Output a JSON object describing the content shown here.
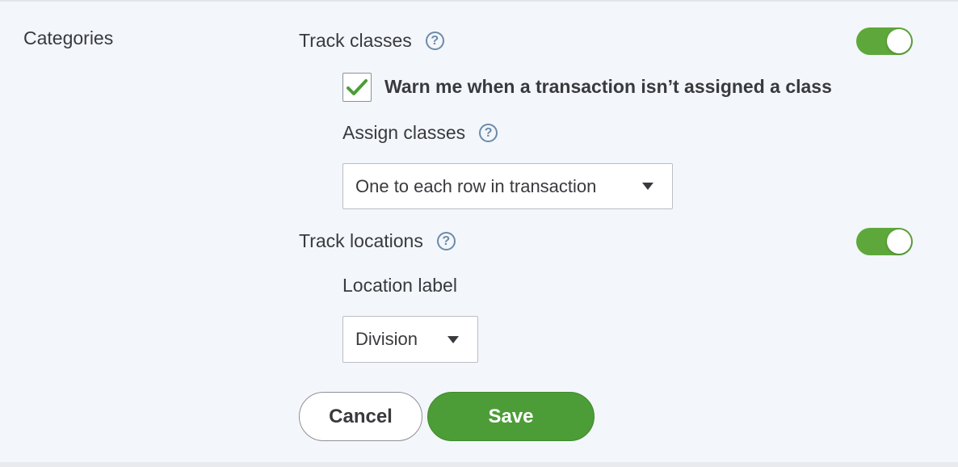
{
  "section": {
    "title": "Categories"
  },
  "track_classes": {
    "label": "Track classes",
    "help": "?",
    "enabled": true,
    "warn": {
      "checked": true,
      "label": "Warn me when a transaction isn’t assigned a class"
    },
    "assign": {
      "label": "Assign classes",
      "help": "?",
      "selected": "One to each row in transaction"
    }
  },
  "track_locations": {
    "label": "Track locations",
    "help": "?",
    "enabled": true,
    "location_label": {
      "label": "Location label",
      "selected": "Division"
    }
  },
  "actions": {
    "cancel_label": "Cancel",
    "save_label": "Save"
  },
  "colors": {
    "toggle_on": "#5ea83b",
    "save_button": "#4c9d37",
    "check_mark": "#4c9d37",
    "help_icon": "#6b8bab"
  }
}
